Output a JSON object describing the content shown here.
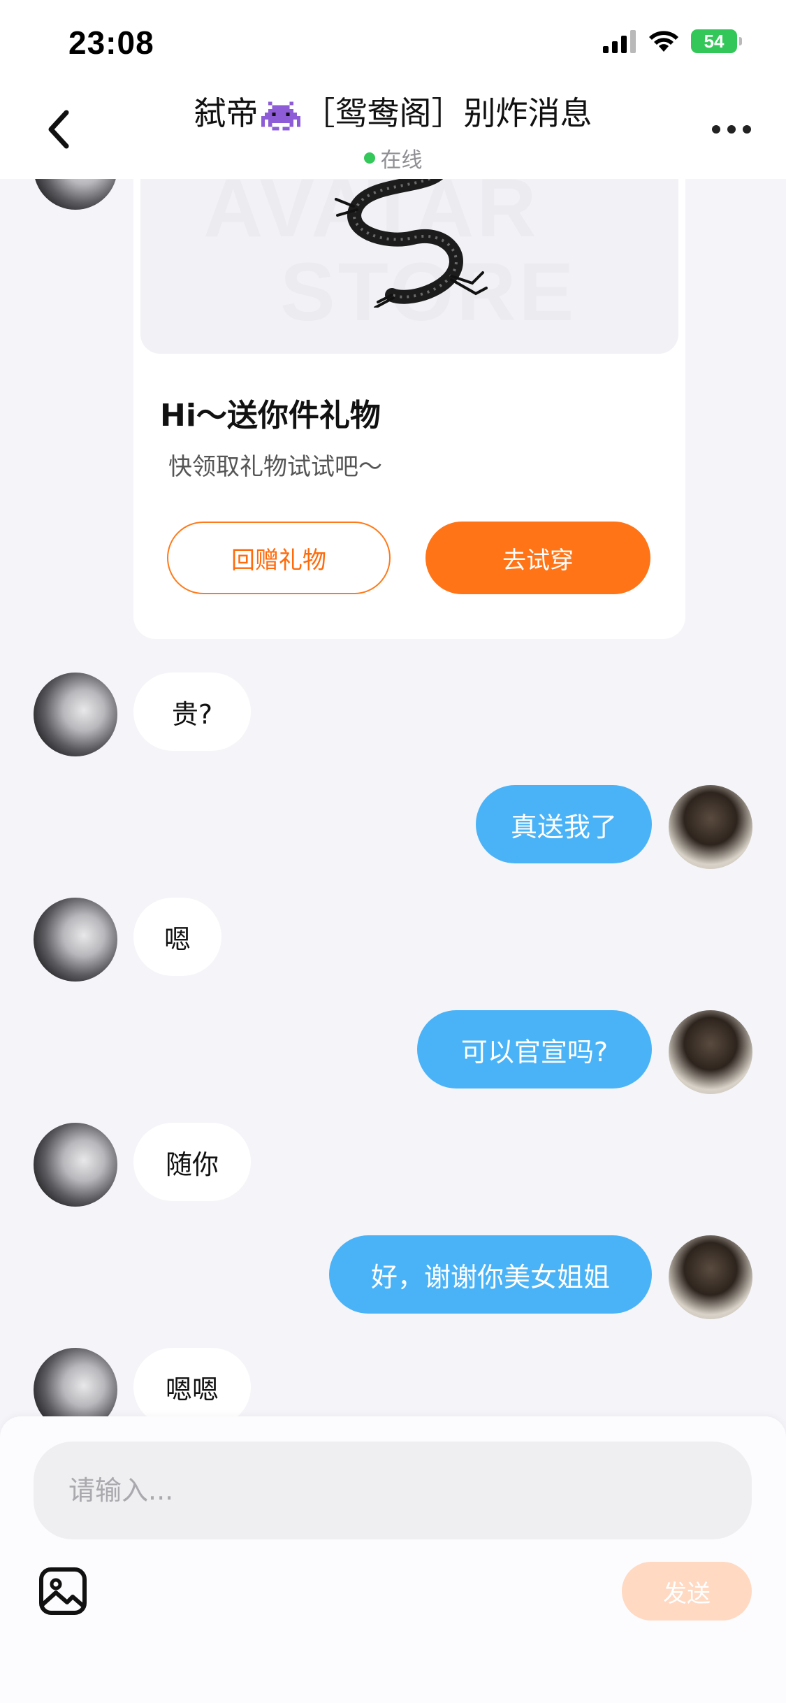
{
  "status_bar": {
    "time": "23:08",
    "battery": "54"
  },
  "header": {
    "title_part1": "弑帝",
    "title_emoji": "alien-monster-emoji",
    "title_part2": "［鸳鸯阁］别炸消息",
    "status": "在线"
  },
  "gift_card": {
    "watermark_line1": "AVATAR",
    "watermark_line2": "STORE",
    "title": "Hi～送你件礼物",
    "subtitle": "快领取礼物试试吧～",
    "return_gift_label": "回赠礼物",
    "try_on_label": "去试穿"
  },
  "messages": [
    {
      "from": "other",
      "text": "贵?"
    },
    {
      "from": "self",
      "text": "真送我了"
    },
    {
      "from": "other",
      "text": "嗯"
    },
    {
      "from": "self",
      "text": "可以官宣吗?"
    },
    {
      "from": "other",
      "text": "随你"
    },
    {
      "from": "self",
      "text": "好，谢谢你美女姐姐"
    },
    {
      "from": "other",
      "text": "嗯嗯"
    }
  ],
  "composer": {
    "placeholder": "请输入...",
    "send_label": "发送"
  },
  "colors": {
    "accent_orange": "#ff7417",
    "outgoing_bubble": "#4ab3f7",
    "online_green": "#34c759",
    "send_disabled": "#ffd9c2"
  },
  "icons": [
    "back-chevron-icon",
    "more-dots-icon",
    "image-icon",
    "signal-icon",
    "wifi-icon",
    "battery-icon",
    "dragon-gift-image"
  ]
}
